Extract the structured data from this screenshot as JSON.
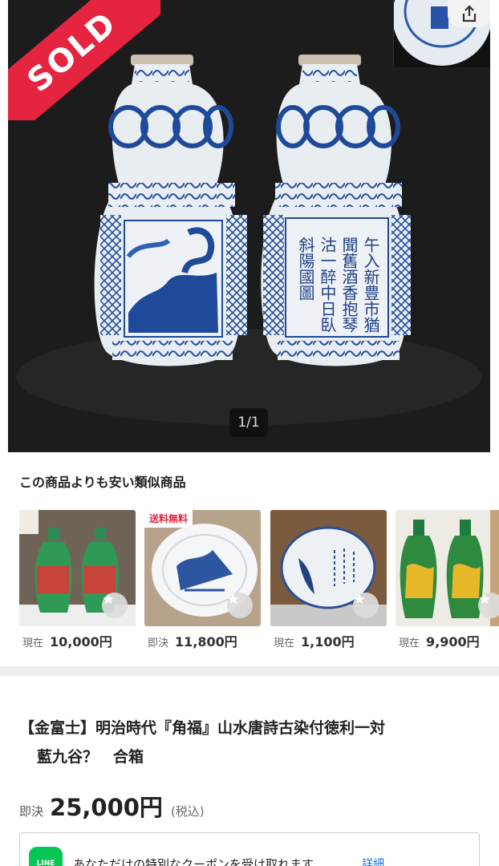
{
  "hero": {
    "sold_label": "SOLD",
    "counter": "1/1",
    "calligraphy_columns": [
      "午入新豊市猶",
      "聞舊酒香抱琴",
      "沽一醉中日臥",
      "斜陽國圖"
    ]
  },
  "similar": {
    "title": "この商品よりも安い類似商品",
    "items": [
      {
        "badge": "",
        "price_label": "現在",
        "price": "10,000円"
      },
      {
        "badge": "送料無料",
        "price_label": "即決",
        "price": "11,800円"
      },
      {
        "badge": "",
        "price_label": "現在",
        "price": "1,100円"
      },
      {
        "badge": "",
        "price_label": "現在",
        "price": "9,900円"
      }
    ]
  },
  "item": {
    "title_line1": "【金富士】明治時代『角福』山水唐詩古染付徳利一対",
    "title_line2": "藍九谷？　合箱",
    "price_label": "即決",
    "price": "25,000円",
    "tax_note": "(税込)"
  },
  "coupon": {
    "logo_text": "LINE",
    "text": "あなただけの特別なクーポンを受け取れます",
    "link": "詳細"
  },
  "colors": {
    "sold_red": "#e5243f",
    "cobalt": "#1f4a9a",
    "line_green": "#06c755",
    "link_blue": "#1a6fd6"
  },
  "icons": [
    "share-icon",
    "star-icon",
    "line-logo-icon"
  ]
}
